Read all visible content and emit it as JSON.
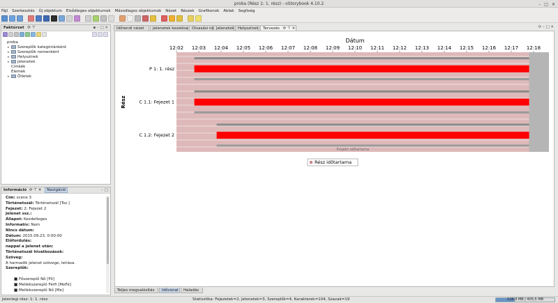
{
  "window": {
    "title": "proba (Rész 1: 1. rész) - oStorybook 4.10.2"
  },
  "menu": [
    "Fájl",
    "Szerkesztés",
    "Új objektum",
    "Elsődleges objektumok",
    "Másodlagos objektumok",
    "Nézet",
    "Részek",
    "Grafikonok",
    "Ablak",
    "Segítség"
  ],
  "left_panel": {
    "title": "Faktúrzet",
    "tree": [
      {
        "label": "proba",
        "level": 0,
        "twisty": ""
      },
      {
        "label": "Szereplők kategóriánként",
        "level": 1,
        "twisty": "▸"
      },
      {
        "label": "Szereplők nemenként",
        "level": 1,
        "twisty": "▸"
      },
      {
        "label": "Helyszínek",
        "level": 1,
        "twisty": "▸"
      },
      {
        "label": "Jelenetek",
        "level": 1,
        "twisty": "▸"
      },
      {
        "label": "Címkék",
        "level": 1,
        "twisty": ""
      },
      {
        "label": "Elemek",
        "level": 1,
        "twisty": ""
      },
      {
        "label": "Ötletek",
        "level": 1,
        "twisty": "▸"
      }
    ]
  },
  "info_panel": {
    "tab_info": "Információ",
    "tab_nav": "Navigáció",
    "lines": [
      {
        "label": "Cím:",
        "value": " scene 3"
      },
      {
        "label": "Történetszál:",
        "value": " Történetszál [Tsz.]"
      },
      {
        "label": "Fejezet:",
        "value": " 2: Fejezet 2"
      },
      {
        "label": "Jelenet ssz.:",
        "value": ""
      },
      {
        "label": "Állapot:",
        "value": " Kezdetleges"
      },
      {
        "label": "Informatív:",
        "value": " Nem"
      },
      {
        "label": "Nincs dátum:",
        "value": ""
      },
      {
        "label": "Dátum:",
        "value": " 2015.09.23. 0:00:00"
      },
      {
        "label": "Előfordulás:",
        "value": ""
      },
      {
        "label": "nappal a jelenet után:",
        "value": ""
      },
      {
        "label": "Történetszál hivatkozások:",
        "value": ""
      },
      {
        "label": "Szöveg:",
        "value": ""
      },
      {
        "label": "",
        "value": "A harmadik jelenet szövege, leírása."
      },
      {
        "label": "Szereplők:",
        "value": ""
      },
      {
        "label": "",
        "value": ""
      },
      {
        "label": "",
        "value": "■ Főszereplő Nő [Fő]"
      },
      {
        "label": "",
        "value": "■ Mellékszereplő Férfi [MeFé]"
      },
      {
        "label": "",
        "value": "■ Mellékszereplő Nő [Me]"
      }
    ]
  },
  "main_tabs": [
    {
      "label": "Időrendi nézet"
    },
    {
      "label": "Jelenetek kezelése"
    },
    {
      "label": "Olvasási nézet"
    },
    {
      "label": "Jelenetek"
    },
    {
      "label": "Helyszínek"
    },
    {
      "label": "Tervezés"
    }
  ],
  "bottom_tabs": [
    {
      "label": "Teljes megvalósítás"
    },
    {
      "label": "Idővonal"
    },
    {
      "label": "Haladás"
    }
  ],
  "status": {
    "left": "Jelenlegi rész: 1: 1. rész",
    "stats": "Statisztika: Fejezetek=2,  Jelenetek=3,  Szereplők=4,  Karakterek=104,  Szavak=19",
    "memory": "128,9 MB | 405,5 MB",
    "memory_fraction": 0.32
  },
  "chart_data": {
    "type": "gantt",
    "title": "Dátum",
    "ylabel": "Rész",
    "x_ticks": [
      "12:02",
      "12:03",
      "12:04",
      "12:05",
      "12:06",
      "12:07",
      "12:08",
      "12:09",
      "12:10",
      "12:11",
      "12:12",
      "12:13",
      "12:14",
      "12:15",
      "12:16",
      "12:17",
      "12:18"
    ],
    "categories": [
      "P 1: 1. rész",
      "C 1.1: Fejezet 1",
      "C 1.2: Fejezet 2"
    ],
    "series": [
      {
        "name": "Rész időtartama",
        "values": [
          {
            "start": "12:02.8",
            "end": "12:17.8"
          },
          {
            "start": "12:02.8",
            "end": "12:17.8"
          },
          {
            "start": "12:03.8",
            "end": "12:17.8"
          }
        ]
      }
    ],
    "annotation": "Projekt időtartama",
    "colors": {
      "bar": "#ff0000",
      "background": "#deb9b9",
      "grid": "#ffffff"
    }
  }
}
